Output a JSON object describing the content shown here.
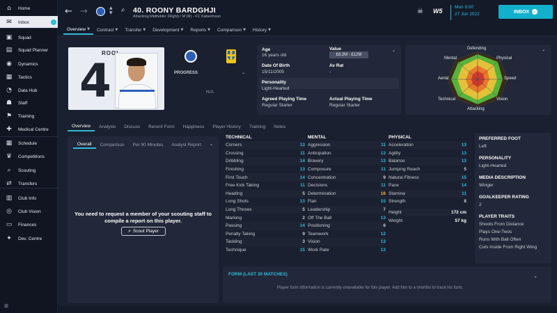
{
  "sidebar": {
    "items": [
      {
        "label": "Home",
        "icon": "home-icon",
        "glyph": "⌂"
      },
      {
        "label": "Inbox",
        "icon": "inbox-icon",
        "glyph": "✉"
      },
      {
        "label": "Squad",
        "icon": "shirt-icon",
        "glyph": "▣"
      },
      {
        "label": "Squad Planner",
        "icon": "planner-icon",
        "glyph": "▤"
      },
      {
        "label": "Dynamics",
        "icon": "dynamics-icon",
        "glyph": "◉"
      },
      {
        "label": "Tactics",
        "icon": "tactics-icon",
        "glyph": "▦"
      },
      {
        "label": "Data Hub",
        "icon": "data-hub-icon",
        "glyph": "◔"
      },
      {
        "label": "Staff",
        "icon": "staff-icon",
        "glyph": "☗"
      },
      {
        "label": "Training",
        "icon": "training-icon",
        "glyph": "⚑"
      },
      {
        "label": "Medical Centre",
        "icon": "medical-icon",
        "glyph": "✚"
      },
      {
        "label": "Schedule",
        "icon": "calendar-icon",
        "glyph": "▦"
      },
      {
        "label": "Competitions",
        "icon": "trophy-icon",
        "glyph": "♛"
      },
      {
        "label": "Scouting",
        "icon": "scouting-icon",
        "glyph": "⌕"
      },
      {
        "label": "Transfers",
        "icon": "transfers-icon",
        "glyph": "⇄"
      },
      {
        "label": "Club Info",
        "icon": "club-info-icon",
        "glyph": "▥"
      },
      {
        "label": "Club Vision",
        "icon": "club-vision-icon",
        "glyph": "◎"
      },
      {
        "label": "Finances",
        "icon": "finances-icon",
        "glyph": "▭"
      },
      {
        "label": "Dev. Centre",
        "icon": "dev-centre-icon",
        "glyph": "✦"
      }
    ]
  },
  "header": {
    "player_name": "40. ROONY BARDGHJI",
    "player_sub": "Attacking Midfielder (Right) / M (R) - FC København",
    "tabs": [
      "Overview",
      "Contract",
      "Transfer",
      "Development",
      "Reports",
      "Comparison",
      "History"
    ],
    "date_day": "Mon 9:00",
    "date_full": "27 Jun 2022",
    "inbox_label": "INBOX",
    "logo_text": "W5"
  },
  "profile": {
    "kit_number": "4",
    "kit_name": "ROOI",
    "progress_label": "PROGRESS",
    "progress_value": "N/A"
  },
  "info": {
    "age_label": "Age",
    "age_value": "16 years old",
    "value_label": "Value",
    "value_value": "£8.2M - £12M",
    "dob_label": "Date Of Birth",
    "dob_value": "15/11/2005",
    "avrat_label": "Av Rat",
    "avrat_value": "-",
    "personality_label": "Personality",
    "personality_value": "Light-Hearted",
    "apt_label": "Agreed Playing Time",
    "apt_value": "Regular Starter",
    "actpt_label": "Actual Playing Time",
    "actpt_value": "Regular Starter"
  },
  "radar": {
    "labels": {
      "defending": "Defending",
      "physical": "Physical",
      "speed": "Speed",
      "vision": "Vision",
      "attacking": "Attacking",
      "technical": "Technical",
      "aerial": "Aerial",
      "mental": "Mental"
    }
  },
  "subtabs": [
    "Overview",
    "Analysis",
    "Discuss",
    "Recent Form",
    "Happiness",
    "Player History",
    "Training",
    "Notes"
  ],
  "scout": {
    "tabs": [
      "Overall",
      "Comparison",
      "Per 90 Minutes",
      "Analyst Report"
    ],
    "message": "You need to request a member of your scouting staff to compile a report on this player.",
    "button": "Scout Player"
  },
  "attributes": {
    "technical_title": "TECHNICAL",
    "mental_title": "MENTAL",
    "physical_title": "PHYSICAL",
    "technical": [
      {
        "name": "Corners",
        "value": "13"
      },
      {
        "name": "Crossing",
        "value": "11"
      },
      {
        "name": "Dribbling",
        "value": "14"
      },
      {
        "name": "Finishing",
        "value": "13"
      },
      {
        "name": "First Touch",
        "value": "14"
      },
      {
        "name": "Free Kick Taking",
        "value": "11"
      },
      {
        "name": "Heading",
        "value": "5"
      },
      {
        "name": "Long Shots",
        "value": "13"
      },
      {
        "name": "Long Throws",
        "value": "5"
      },
      {
        "name": "Marking",
        "value": "2"
      },
      {
        "name": "Passing",
        "value": "14"
      },
      {
        "name": "Penalty Taking",
        "value": "9"
      },
      {
        "name": "Tackling",
        "value": "3"
      },
      {
        "name": "Technique",
        "value": "15"
      }
    ],
    "mental": [
      {
        "name": "Aggression",
        "value": "11"
      },
      {
        "name": "Anticipation",
        "value": "13"
      },
      {
        "name": "Bravery",
        "value": "13"
      },
      {
        "name": "Composure",
        "value": "11"
      },
      {
        "name": "Concentration",
        "value": "9"
      },
      {
        "name": "Decisions",
        "value": "11"
      },
      {
        "name": "Determination",
        "value": "16"
      },
      {
        "name": "Flair",
        "value": "15"
      },
      {
        "name": "Leadership",
        "value": "7"
      },
      {
        "name": "Off The Ball",
        "value": "13"
      },
      {
        "name": "Positioning",
        "value": "6"
      },
      {
        "name": "Teamwork",
        "value": "12"
      },
      {
        "name": "Vision",
        "value": "13"
      },
      {
        "name": "Work Rate",
        "value": "13"
      }
    ],
    "physical": [
      {
        "name": "Acceleration",
        "value": "13"
      },
      {
        "name": "Agility",
        "value": "13"
      },
      {
        "name": "Balance",
        "value": "13"
      },
      {
        "name": "Jumping Reach",
        "value": "5"
      },
      {
        "name": "Natural Fitness",
        "value": "15"
      },
      {
        "name": "Pace",
        "value": "14"
      },
      {
        "name": "Stamina",
        "value": "11"
      },
      {
        "name": "Strength",
        "value": "8"
      }
    ],
    "height_label": "Height",
    "height_value": "172 cm",
    "weight_label": "Weight",
    "weight_value": "57 kg"
  },
  "details": {
    "foot_label": "PREFERRED FOOT",
    "foot_value": "Left",
    "personality_label": "PERSONALITY",
    "personality_value": "Light-Hearted",
    "media_label": "MEDIA DESCRIPTION",
    "media_value": "Winger",
    "gk_label": "GOALKEEPER RATING",
    "gk_value": "2",
    "traits_label": "PLAYER TRAITS",
    "traits": [
      "Shoots From Distance",
      "Plays One-Twos",
      "Runs With Ball Often",
      "Cuts Inside From Right Wing"
    ]
  },
  "form": {
    "title": "FORM (LAST 30 MATCHES)",
    "message": "Player form information is currently unavailable for this player. Add him to a shortlist to track his form."
  },
  "colors": {
    "accent": "#2fbbd9",
    "inbox": "#13b0cb",
    "attr_low": "#c9cdd6",
    "attr_mid": "#2fbbd9",
    "attr_high": "#f0b429"
  }
}
